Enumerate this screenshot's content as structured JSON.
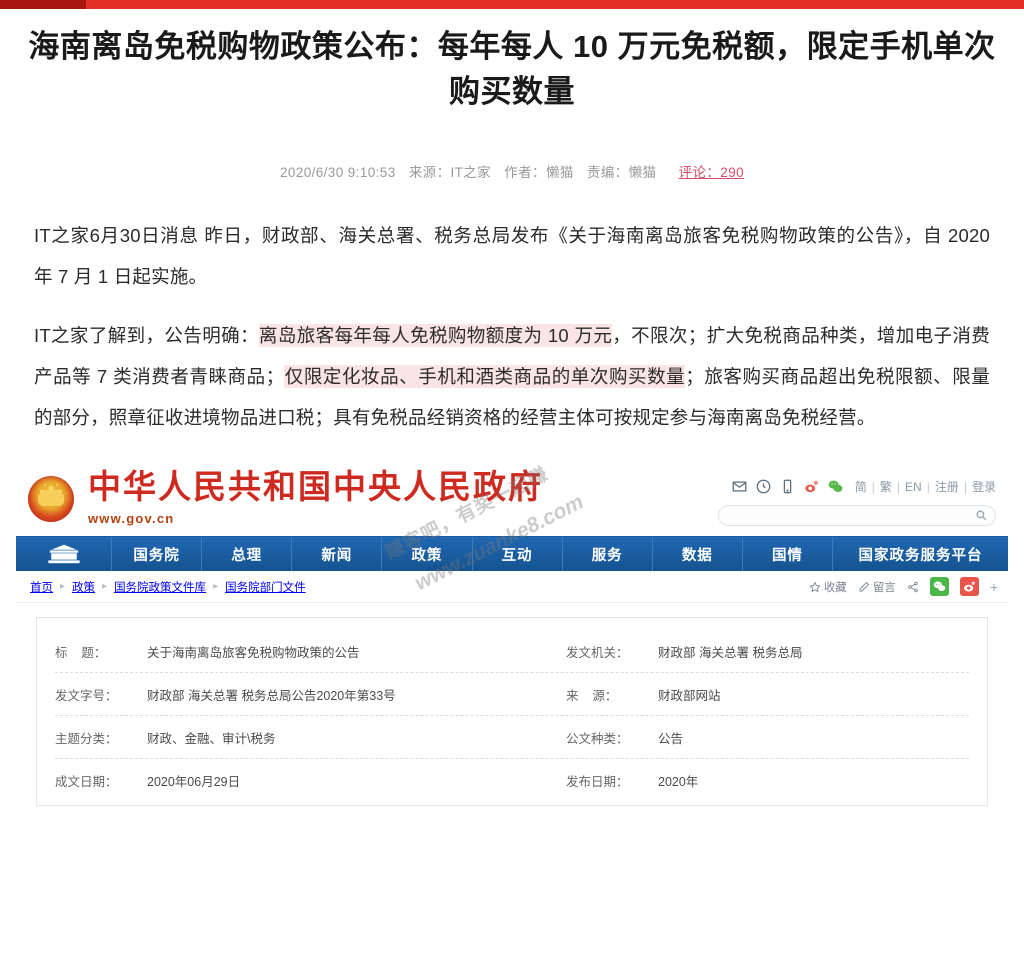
{
  "topbar": {
    "accent_dark": "#a8170f",
    "accent_light": "#e33127"
  },
  "article": {
    "headline": "海南离岛免税购物政策公布：每年每人 10 万元免税额，限定手机单次购买数量",
    "meta": {
      "datetime": "2020/6/30 9:10:53",
      "source_label": "来源：",
      "source": "IT之家",
      "author_label": "作者：",
      "author": "懒猫",
      "editor_label": "责编：",
      "editor": "懒猫",
      "comments": "评论：290",
      "comments_color": "#d4506a"
    },
    "paragraph1": {
      "lead": "IT之家6月30日消息 ",
      "text": "昨日，财政部、海关总署、税务总局发布《关于海南离岛旅客免税购物政策的公告》，自 2020 年 7 月 1 日起实施。"
    },
    "paragraph2": {
      "part1": "IT之家了解到，公告明确：",
      "highlight1": "离岛旅客每年每人免税购物额度为 10 万元",
      "part2": "，不限次；扩大免税商品种类，增加电子消费产品等 7 类消费者青睐商品；",
      "highlight2": "仅限定化妆品、手机和酒类商品的单次购买数量",
      "part3": "；旅客购买商品超出免税限额、限量的部分，照章征收进境物品进口税；具有免税品经销资格的经营主体可按规定参与海南离岛免税经营。"
    },
    "highlight_color": "#fbe4e4"
  },
  "watermark": {
    "line1": "赚客吧，有奖一起赚",
    "line2": "www.zuanke8.com"
  },
  "gov": {
    "brand": {
      "emblem": "national-emblem",
      "title": "中华人民共和国中央人民政府",
      "url": "www.gov.cn",
      "title_color": "#cf2a20"
    },
    "utility_icons": [
      {
        "name": "mail-icon"
      },
      {
        "name": "clock-icon"
      },
      {
        "name": "mobile-icon"
      },
      {
        "name": "weibo-icon"
      },
      {
        "name": "wechat-icon"
      }
    ],
    "utility_links": [
      "简",
      "繁",
      "EN",
      "注册",
      "登录"
    ],
    "search": {
      "value": "",
      "placeholder": "",
      "icon": "search-icon"
    },
    "nav": {
      "home_icon": "gov-building-icon",
      "items": [
        "国务院",
        "总理",
        "新闻",
        "政策",
        "互动",
        "服务",
        "数据",
        "国情",
        "国家政务服务平台"
      ],
      "bg_color": "#1b5fa8"
    },
    "breadcrumbs": [
      "首页",
      "政策",
      "国务院政策文件库",
      "国务院部门文件"
    ],
    "actions": [
      {
        "name": "favorite-button",
        "label": "收藏",
        "icon": "star-icon"
      },
      {
        "name": "message-button",
        "label": "留言",
        "icon": "pencil-icon"
      },
      {
        "name": "share-button",
        "label": "",
        "icon": "share-icon"
      },
      {
        "name": "wechat-share-button",
        "label": "",
        "icon": "wechat-icon"
      },
      {
        "name": "weibo-share-button",
        "label": "",
        "icon": "weibo-icon"
      },
      {
        "name": "more-share-button",
        "label": "+",
        "icon": "plus-icon"
      }
    ],
    "info_table": [
      [
        {
          "label": "标    题：",
          "value": "关于海南离岛旅客免税购物政策的公告"
        },
        {
          "label": "发文机关：",
          "value": "财政部 海关总署 税务总局"
        }
      ],
      [
        {
          "label": "发文字号：",
          "value": "财政部 海关总署 税务总局公告2020年第33号"
        },
        {
          "label": "来    源：",
          "value": "财政部网站"
        }
      ],
      [
        {
          "label": "主题分类：",
          "value": "财政、金融、审计\\税务"
        },
        {
          "label": "公文种类：",
          "value": "公告"
        }
      ],
      [
        {
          "label": "成文日期：",
          "value": "2020年06月29日"
        },
        {
          "label": "发布日期：",
          "value": "2020年"
        }
      ]
    ]
  }
}
